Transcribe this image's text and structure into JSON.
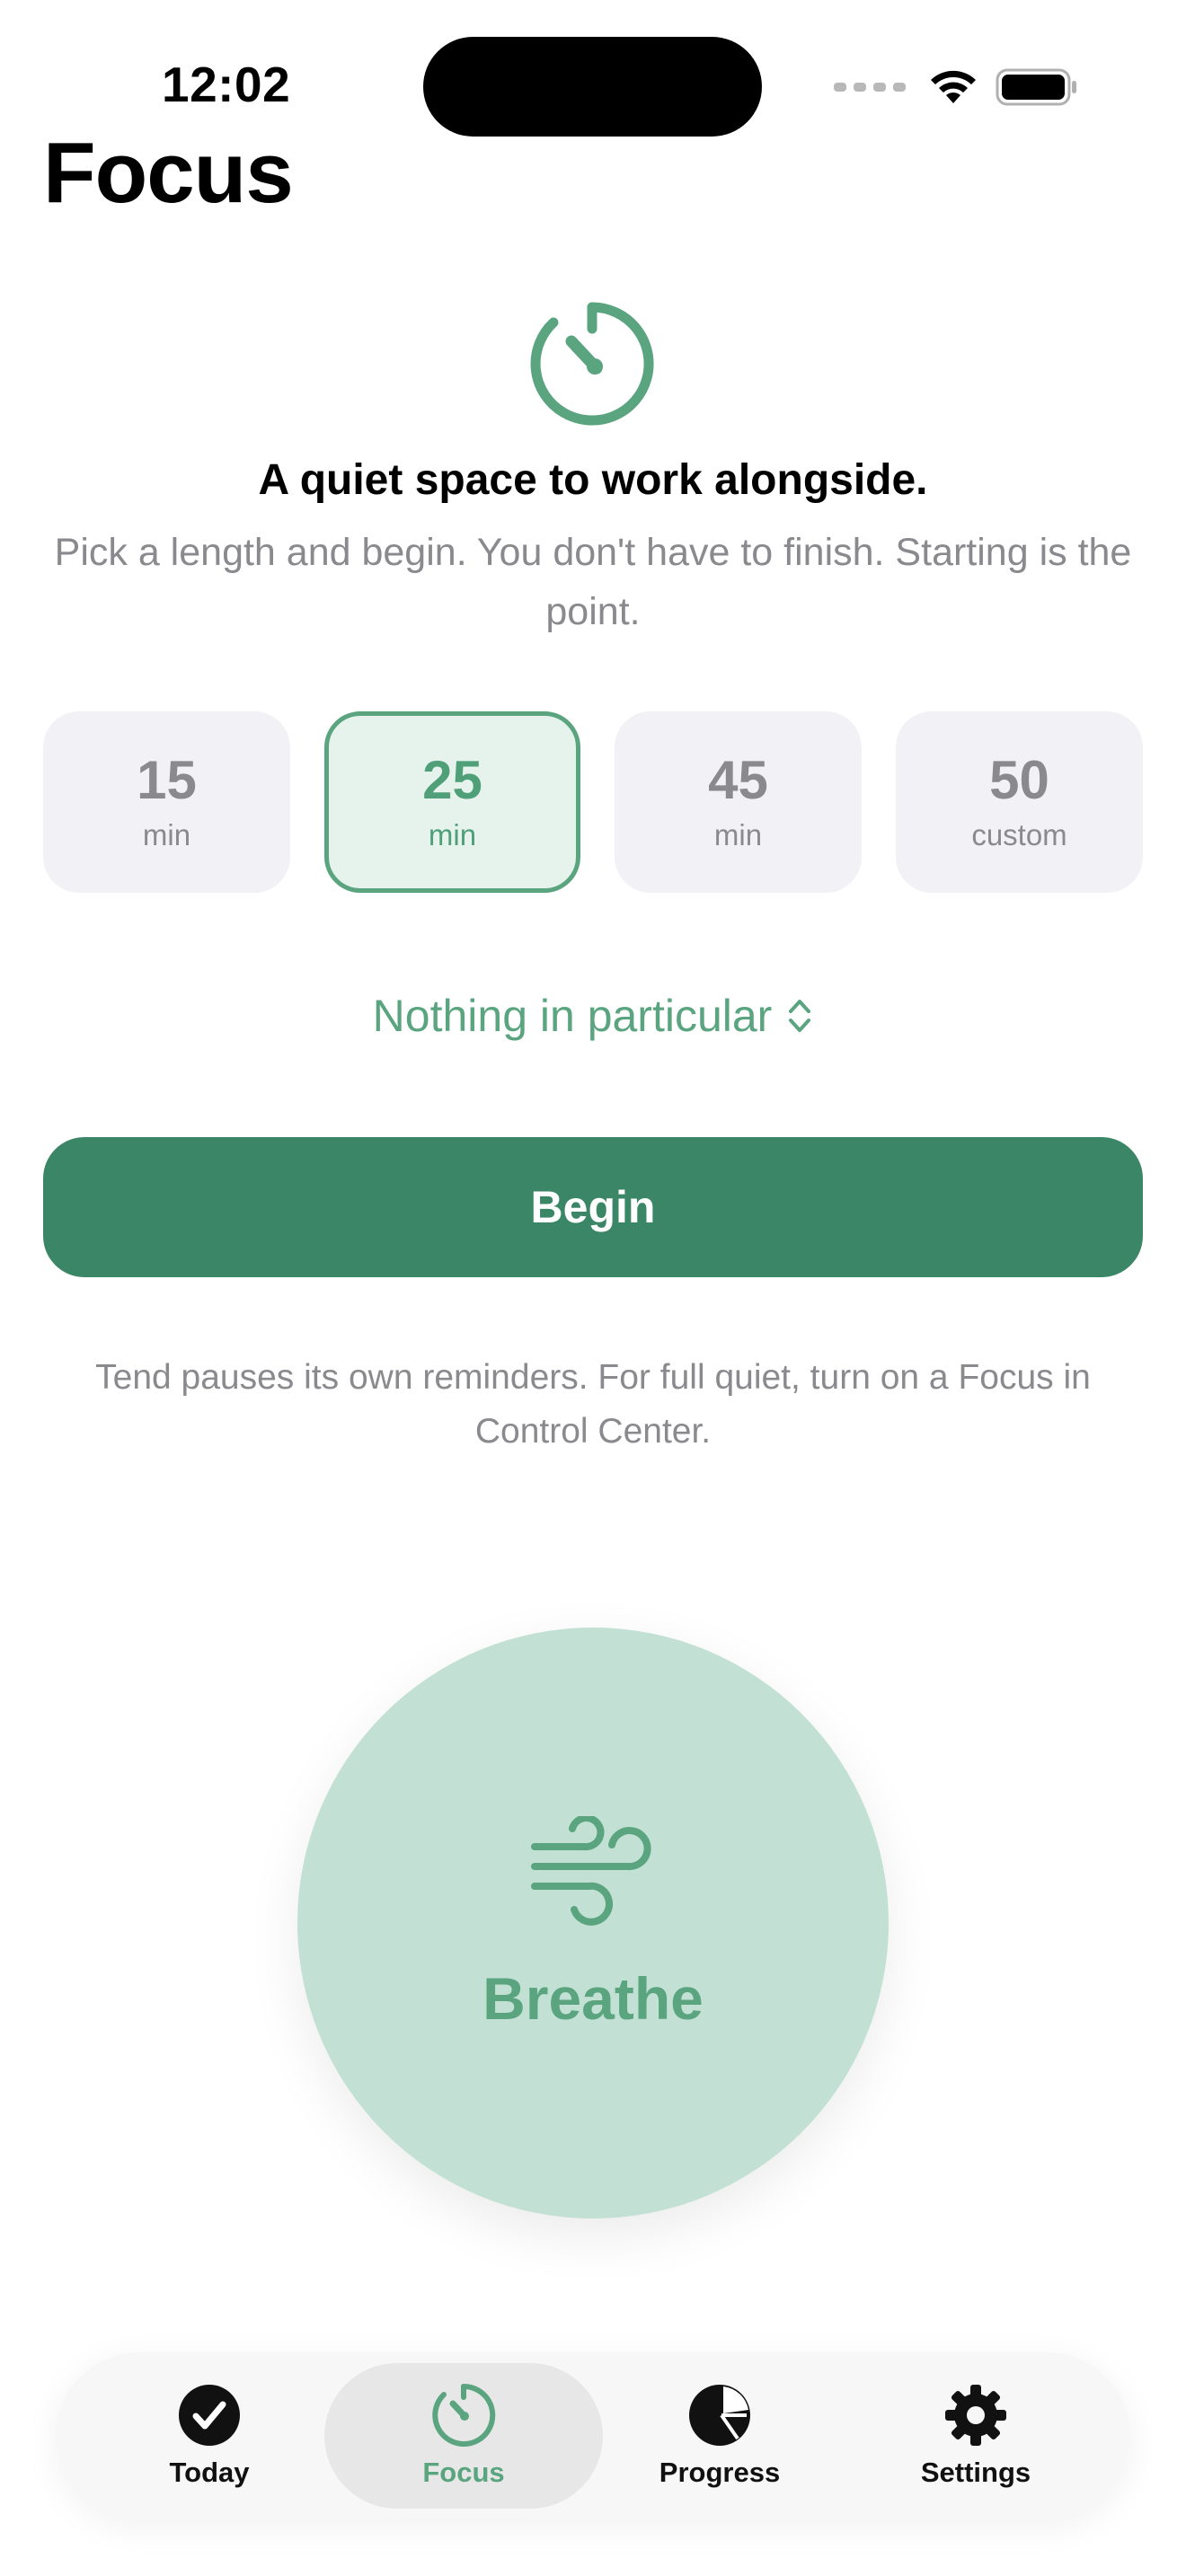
{
  "status_bar": {
    "time": "12:02"
  },
  "header": {
    "title": "Focus"
  },
  "intro": {
    "headline": "A quiet space to work alongside.",
    "subline": "Pick a length and begin. You don't have to finish. Starting is the point."
  },
  "durations": [
    {
      "value": "15",
      "unit": "min",
      "selected": false
    },
    {
      "value": "25",
      "unit": "min",
      "selected": true
    },
    {
      "value": "45",
      "unit": "min",
      "selected": false
    },
    {
      "value": "50",
      "unit": "custom",
      "selected": false
    }
  ],
  "intent": {
    "label": "Nothing in particular"
  },
  "begin_button": {
    "label": "Begin"
  },
  "note": "Tend pauses its own reminders. For full quiet, turn on a Focus in Control Center.",
  "breathe": {
    "label": "Breathe",
    "icon": "wind-icon"
  },
  "tabbar": {
    "items": [
      {
        "label": "Today",
        "icon": "checkmark-circle-icon",
        "active": false
      },
      {
        "label": "Focus",
        "icon": "timer-icon",
        "active": true
      },
      {
        "label": "Progress",
        "icon": "pie-chart-icon",
        "active": false
      },
      {
        "label": "Settings",
        "icon": "gear-icon",
        "active": false
      }
    ]
  },
  "colors": {
    "accent": "#5aa580",
    "primary_button": "#3a8667",
    "breathe_bg": "#c2e0d3",
    "pill_bg": "#f2f2f6",
    "secondary_text": "#8a8a8e"
  }
}
